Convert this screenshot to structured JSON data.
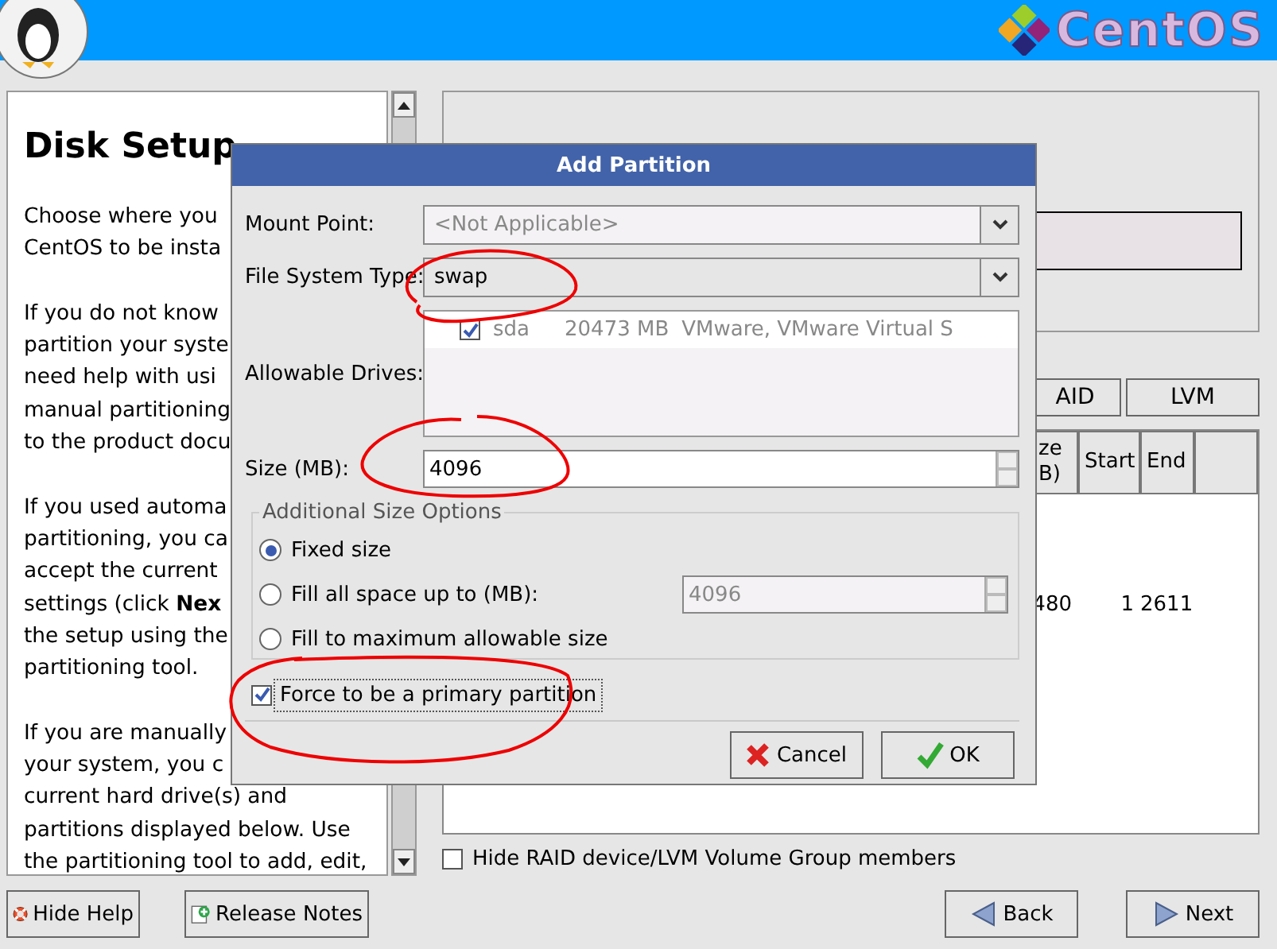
{
  "header": {
    "logo_text": "CentOS"
  },
  "help": {
    "title": "Disk Setup",
    "paragraphs": [
      [
        "Choose where you",
        "CentOS to be insta"
      ],
      [
        "If you do not know",
        "partition your syste",
        "need help with usi",
        "manual partitioning",
        "to the product docu"
      ],
      [
        "If you used automa",
        "partitioning, you ca",
        "accept the current",
        "settings (click **Nex**",
        "the setup using the",
        "partitioning tool."
      ],
      [
        "If you are manually",
        "your system, you c",
        "current hard drive(s) and",
        "partitions displayed below. Use",
        "the partitioning tool to add, edit,"
      ]
    ]
  },
  "drive_buttons": [
    {
      "label": "AID"
    },
    {
      "label": "LVM"
    }
  ],
  "table": {
    "columns": [
      "ze B)",
      "Start",
      "End"
    ],
    "rows": [
      [
        "480",
        "1",
        "2611"
      ]
    ]
  },
  "hide_members": {
    "label": "Hide RAID device/LVM Volume Group members",
    "checked": false
  },
  "footer": [
    {
      "label": "Hide Help",
      "kind": "help"
    },
    {
      "label": "Release Notes",
      "kind": "notes"
    },
    {
      "label": "Back",
      "kind": "back"
    },
    {
      "label": "Next",
      "kind": "next"
    }
  ],
  "dialog": {
    "title": "Add Partition",
    "mount_point": {
      "label": "Mount Point:",
      "value": "<Not Applicable>",
      "disabled": true
    },
    "fs_type": {
      "label": "File System Type:",
      "value": "swap"
    },
    "drives": {
      "label": "Allowable Drives:",
      "items": [
        {
          "name": "sda",
          "size": "20473 MB",
          "model": "VMware, VMware Virtual S",
          "checked": true
        }
      ]
    },
    "size": {
      "label": "Size (MB):",
      "value": "4096"
    },
    "size_options": {
      "title": "Additional Size Options",
      "options": [
        {
          "label": "Fixed size",
          "selected": true
        },
        {
          "label": "Fill all space up to (MB):",
          "selected": false,
          "value": "4096"
        },
        {
          "label": "Fill to maximum allowable size",
          "selected": false
        }
      ]
    },
    "primary": {
      "label": "Force to be a primary partition",
      "checked": true
    },
    "buttons": [
      {
        "label": "Cancel",
        "kind": "cancel"
      },
      {
        "label": "OK",
        "kind": "ok"
      }
    ]
  }
}
